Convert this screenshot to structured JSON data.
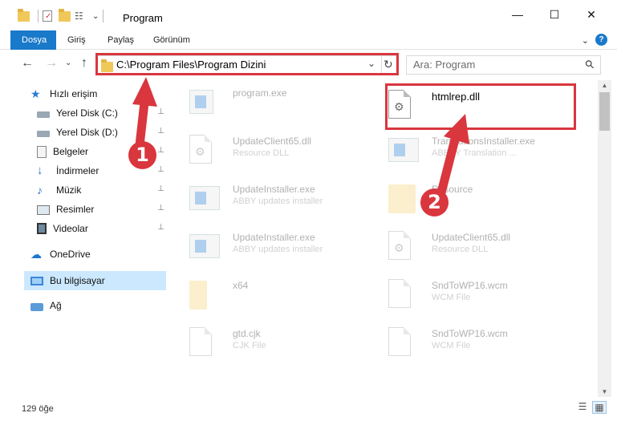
{
  "window": {
    "title": "Program",
    "minimize_glyph": "—",
    "maximize_glyph": "☐",
    "close_glyph": "✕"
  },
  "ribbon": {
    "tabs": [
      "Dosya",
      "Giriş",
      "Paylaş",
      "Görünüm"
    ],
    "help_glyph": "?",
    "collapse_glyph": "⌄"
  },
  "address": {
    "path": "C:\\Program Files\\Program Dizini",
    "search_placeholder": "Ara: Program",
    "back_glyph": "←",
    "forward_glyph": "→",
    "recent_glyph": "⌄",
    "up_glyph": "↑",
    "dropdown_glyph": "⌄",
    "refresh_glyph": "↻",
    "search_glyph": "⚲"
  },
  "sidebar": {
    "items": [
      {
        "label": "Hızlı erişim",
        "icon": "star-icon"
      },
      {
        "label": "Yerel Disk (C:)",
        "icon": "drive-icon"
      },
      {
        "label": "Yerel Disk (D:)",
        "icon": "drive-icon"
      },
      {
        "label": "Belgeler",
        "icon": "documents-icon"
      },
      {
        "label": "İndirmeler",
        "icon": "download-icon"
      },
      {
        "label": "Müzik",
        "icon": "music-icon"
      },
      {
        "label": "Resimler",
        "icon": "pictures-icon"
      },
      {
        "label": "Videolar",
        "icon": "videos-icon"
      },
      {
        "label": "OneDrive",
        "icon": "cloud-icon"
      },
      {
        "label": "Bu bilgisayar",
        "icon": "computer-icon"
      },
      {
        "label": "Ağ",
        "icon": "network-icon"
      }
    ],
    "pin_glyph": "📌"
  },
  "files": [
    {
      "name": "program.exe",
      "sub": ""
    },
    {
      "name": "htmlrep.dll",
      "sub": ""
    },
    {
      "name": "UpdateClient65.dll",
      "sub": "Resource DLL"
    },
    {
      "name": "TranslationsInstaller.exe",
      "sub": "ABBYY Translation ..."
    },
    {
      "name": "UpdateInstaller.exe",
      "sub": "ABBY updates installer"
    },
    {
      "name": "Resource",
      "sub": ""
    },
    {
      "name": "UpdateInstaller.exe",
      "sub": "ABBY updates installer"
    },
    {
      "name": "UpdateClient65.dll",
      "sub": "Resource DLL"
    },
    {
      "name": "x64",
      "sub": ""
    },
    {
      "name": "SndToWP16.wcm",
      "sub": "WCM File"
    },
    {
      "name": "gtd.cjk",
      "sub": "CJK File"
    },
    {
      "name": "SndToWP16.wcm",
      "sub": "WCM File"
    }
  ],
  "status": {
    "count": "129 öğe"
  },
  "markers": [
    "1",
    "2"
  ],
  "colors": {
    "accent": "#1979ca",
    "highlight": "#d9363e",
    "selection": "#cce8ff"
  }
}
